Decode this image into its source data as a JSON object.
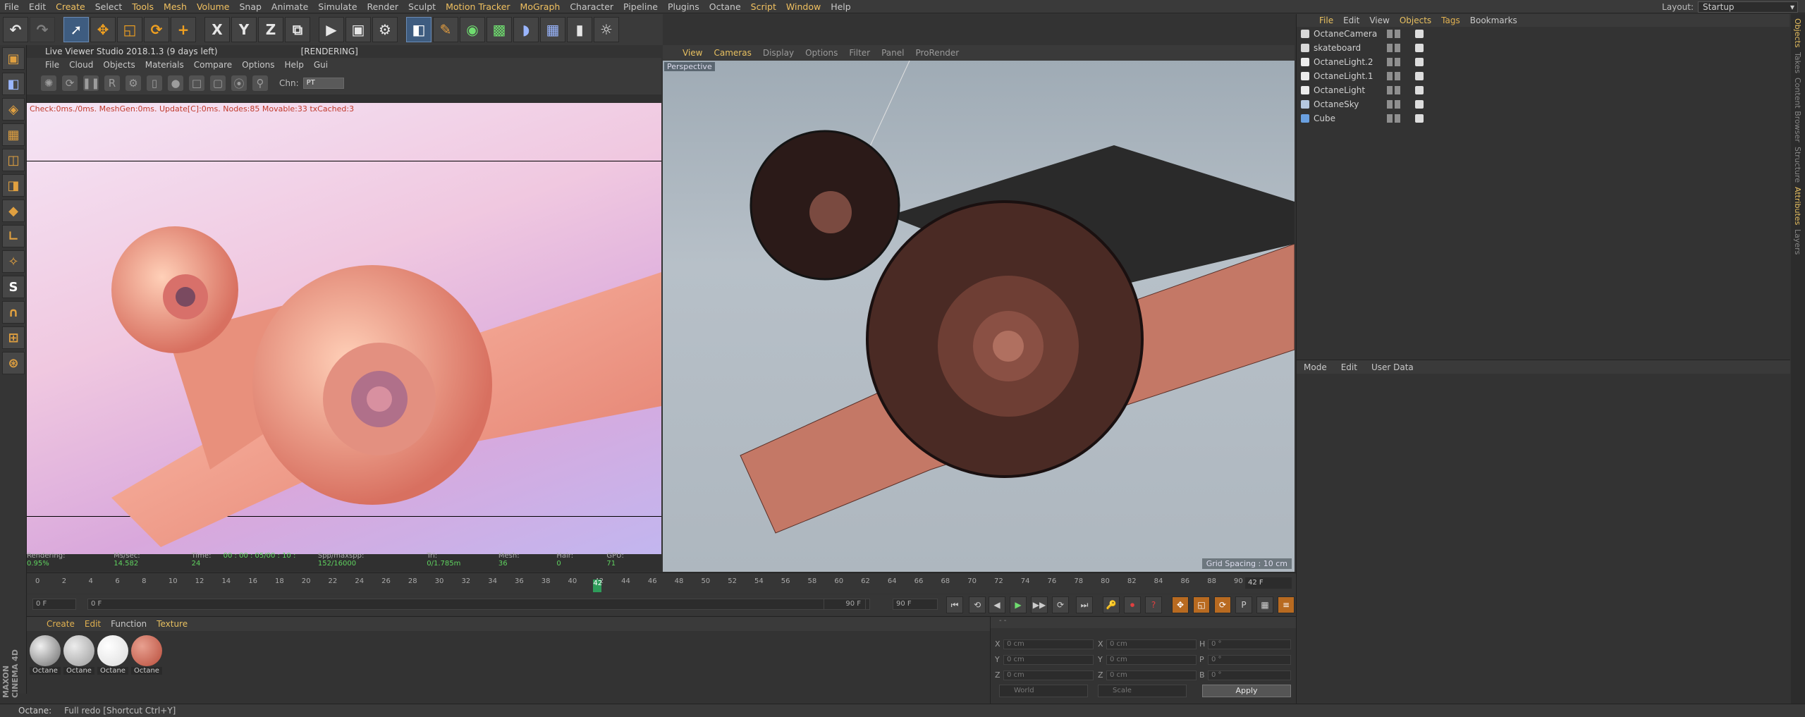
{
  "menubar": {
    "items": [
      "File",
      "Edit",
      "Create",
      "Select",
      "Tools",
      "Mesh",
      "Volume",
      "Snap",
      "Animate",
      "Simulate",
      "Render",
      "Sculpt",
      "Motion Tracker",
      "MoGraph",
      "Character",
      "Pipeline",
      "Plugins",
      "Octane",
      "Script",
      "Window",
      "Help"
    ],
    "highlighted": [
      "Create",
      "Tools",
      "Mesh",
      "Volume",
      "Motion Tracker",
      "MoGraph",
      "Script",
      "Window"
    ],
    "layout_label": "Layout:",
    "layout_value": "Startup"
  },
  "toolbar": {
    "axis_x": "X",
    "axis_y": "Y",
    "axis_z": "Z"
  },
  "live_viewer": {
    "title": "Live Viewer Studio 2018.1.3 (9 days left)",
    "status": "[RENDERING]",
    "menu": [
      "File",
      "Cloud",
      "Objects",
      "Materials",
      "Compare",
      "Options",
      "Help",
      "Gui"
    ],
    "chn_label": "Chn:",
    "chn_value": "PT",
    "log": "Check:0ms./0ms. MeshGen:0ms. Update[C]:0ms. Nodes:85 Movable:33 txCached:3"
  },
  "render_stats": {
    "rendering_label": "Rendering:",
    "rendering_value": "0.95%",
    "ms_label": "Ms/sec:",
    "ms_value": "14.582",
    "time_label": "Time:",
    "time_value": "00 : 00 : 05/00 : 10 : 24",
    "spp_label": "Spp/maxspp:",
    "spp_value": "152/16000",
    "tri_label": "Tri:",
    "tri_value": "0/1.785m",
    "mesh_label": "Mesh:",
    "mesh_value": "36",
    "hair_label": "Hair:",
    "hair_value": "0",
    "gpu_label": "GPU:",
    "gpu_value": "71"
  },
  "viewport": {
    "menu": [
      "View",
      "Cameras",
      "Display",
      "Options",
      "Filter",
      "Panel",
      "ProRender"
    ],
    "label": "Perspective",
    "grid_spacing": "Grid Spacing : 10 cm"
  },
  "object_manager": {
    "menu": [
      "File",
      "Edit",
      "View",
      "Objects",
      "Tags",
      "Bookmarks"
    ],
    "objects": [
      {
        "name": "OctaneCamera",
        "color": "#d8d8d8"
      },
      {
        "name": "skateboard",
        "color": "#d8d8d8"
      },
      {
        "name": "OctaneLight.2",
        "color": "#ececec"
      },
      {
        "name": "OctaneLight.1",
        "color": "#ececec"
      },
      {
        "name": "OctaneLight",
        "color": "#ececec"
      },
      {
        "name": "OctaneSky",
        "color": "#b5c7e0"
      },
      {
        "name": "Cube",
        "color": "#6aa0e0"
      }
    ]
  },
  "attribute_manager": {
    "menu": [
      "Mode",
      "Edit",
      "User Data"
    ]
  },
  "side_tabs": [
    "Objects",
    "Takes",
    "Content Browser",
    "Structure",
    "Attributes",
    "Layers"
  ],
  "timeline": {
    "ticks": [
      "0",
      "2",
      "4",
      "6",
      "8",
      "10",
      "12",
      "14",
      "16",
      "18",
      "20",
      "22",
      "24",
      "26",
      "28",
      "30",
      "32",
      "34",
      "36",
      "38",
      "40",
      "42",
      "44",
      "46",
      "48",
      "50",
      "52",
      "54",
      "56",
      "58",
      "60",
      "62",
      "64",
      "66",
      "68",
      "70",
      "72",
      "74",
      "76",
      "78",
      "80",
      "82",
      "84",
      "86",
      "88",
      "90"
    ],
    "playhead": "42",
    "frame_display": "42 F"
  },
  "transport": {
    "start": "0 F",
    "current": "0 F",
    "end": "90 F",
    "end2": "90 F"
  },
  "material_manager": {
    "menu": [
      "Create",
      "Edit",
      "Function",
      "Texture"
    ],
    "materials": [
      {
        "name": "Octane",
        "color1": "#6a6a6a",
        "color2": "#f0f0f0"
      },
      {
        "name": "Octane",
        "color1": "#9a9a9a",
        "color2": "#ececec"
      },
      {
        "name": "Octane",
        "color1": "#dcdcdc",
        "color2": "#ffffff"
      },
      {
        "name": "Octane",
        "color1": "#b84c3a",
        "color2": "#e8a090"
      }
    ]
  },
  "coordinates": {
    "x_pos": "0 cm",
    "y_pos": "0 cm",
    "z_pos": "0 cm",
    "x_size": "0 cm",
    "y_size": "0 cm",
    "z_size": "0 cm",
    "h": "0 °",
    "p": "0 °",
    "b": "0 °",
    "world": "World",
    "scale": "Scale",
    "apply": "Apply"
  },
  "status": {
    "label": "Octane:",
    "message": "Full redo [Shortcut Ctrl+Y]"
  },
  "maxon_logo": "MAXON CINEMA 4D"
}
